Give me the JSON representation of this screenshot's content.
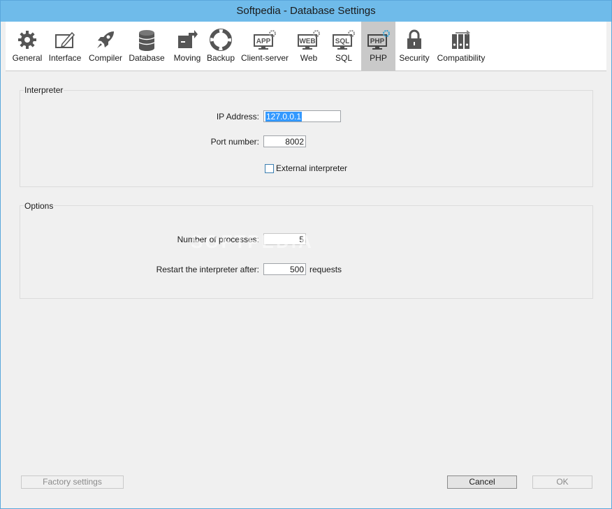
{
  "window": {
    "title": "Softpedia - Database Settings"
  },
  "tabs": [
    {
      "label": "General",
      "icon": "gear-icon"
    },
    {
      "label": "Interface",
      "icon": "pencil-window-icon"
    },
    {
      "label": "Compiler",
      "icon": "rocket-icon"
    },
    {
      "label": "Database",
      "icon": "database-icon"
    },
    {
      "label": "Moving",
      "icon": "move-box-icon"
    },
    {
      "label": "Backup",
      "icon": "lifebuoy-icon"
    },
    {
      "label": "Client-server",
      "icon": "app-gear-icon",
      "icon_text": "APP"
    },
    {
      "label": "Web",
      "icon": "web-gear-icon",
      "icon_text": "WEB"
    },
    {
      "label": "SQL",
      "icon": "sql-gear-icon",
      "icon_text": "SQL"
    },
    {
      "label": "PHP",
      "icon": "php-gear-icon",
      "icon_text": "PHP",
      "active": true
    },
    {
      "label": "Security",
      "icon": "lock-icon"
    },
    {
      "label": "Compatibility",
      "icon": "binders-icon"
    }
  ],
  "interpreter": {
    "title": "Interpreter",
    "ip_label": "IP Address:",
    "ip_value": "127.0.0.1",
    "port_label": "Port number:",
    "port_value": "8002",
    "external_label": "External interpreter",
    "external_checked": false
  },
  "options": {
    "title": "Options",
    "processes_label": "Number of processes:",
    "processes_value": "5",
    "restart_label": "Restart the interpreter after:",
    "restart_value": "500",
    "restart_unit": "requests"
  },
  "footer": {
    "factory_label": "Factory settings",
    "cancel_label": "Cancel",
    "ok_label": "OK"
  },
  "watermark": "SOFTPEDIA",
  "colors": {
    "titlebar": "#6fbbea",
    "active_tab": "#c9c9c9",
    "selection": "#3399ff",
    "icon": "#555555"
  }
}
